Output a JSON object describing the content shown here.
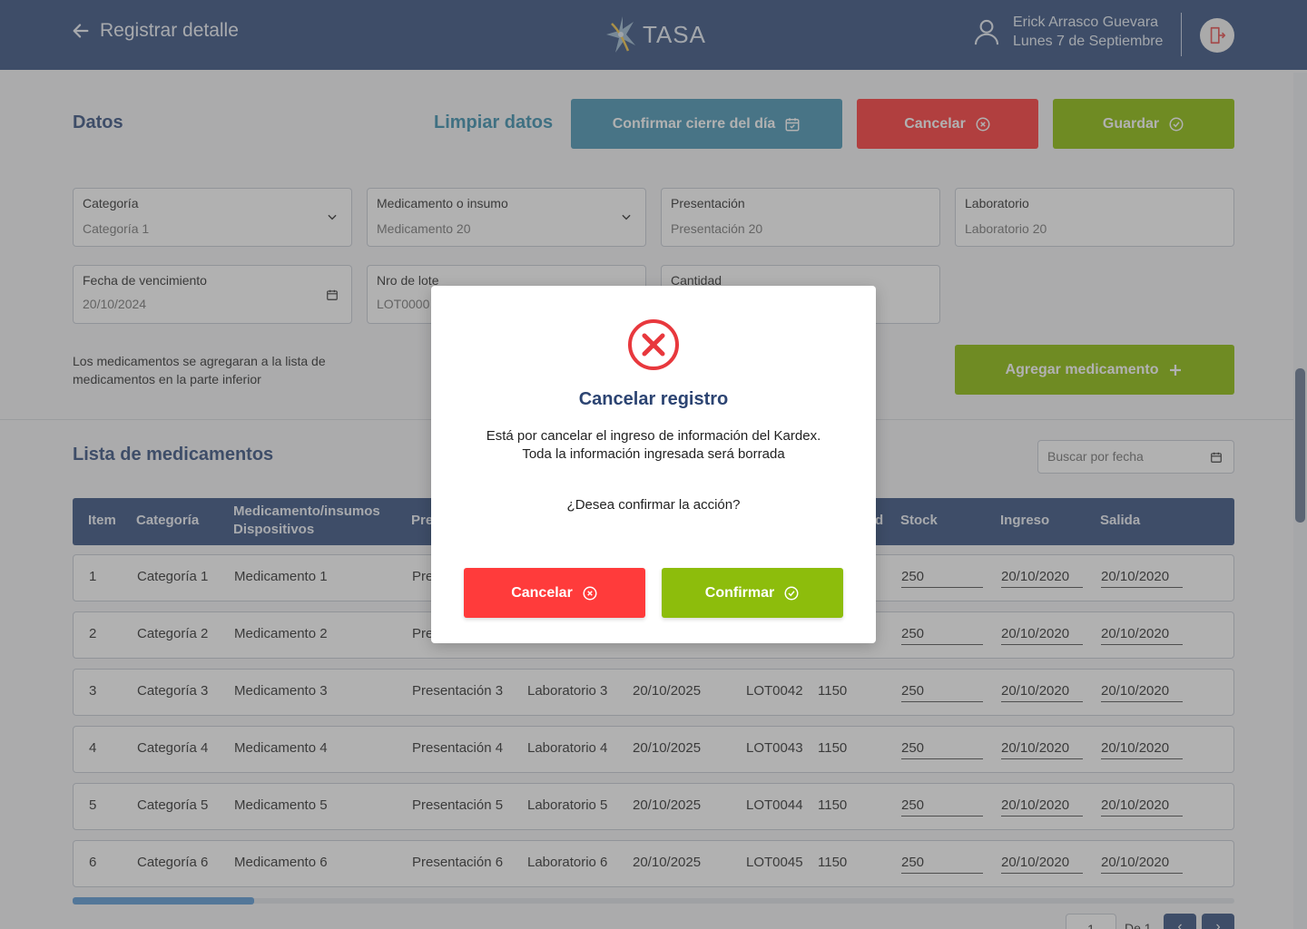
{
  "header": {
    "back_label": "Registrar detalle",
    "logo_text": "TASA",
    "user_name": "Erick Arrasco Guevara",
    "date": "Lunes 7 de Septiembre"
  },
  "datos": {
    "title": "Datos",
    "clear_label": "Limpiar datos",
    "confirm_close_label": "Confirmar cierre del día",
    "cancel_label": "Cancelar",
    "save_label": "Guardar"
  },
  "fields": {
    "categoria": {
      "label": "Categoría",
      "value": "Categoría 1"
    },
    "medicamento": {
      "label": "Medicamento o insumo",
      "value": "Medicamento 20"
    },
    "presentacion": {
      "label": "Presentación",
      "value": "Presentación 20"
    },
    "laboratorio": {
      "label": "Laboratorio",
      "value": "Laboratorio 20"
    },
    "fecha": {
      "label": "Fecha de vencimiento",
      "value": "20/10/2024"
    },
    "lote": {
      "label": "Nro de lote",
      "value": "LOT0000"
    },
    "cantidad": {
      "label": "Cantidad",
      "value": ""
    }
  },
  "note": "Los medicamentos se agregaran a la lista de medicamentos en la parte inferior",
  "add_label": "Agregar medicamento",
  "list": {
    "title": "Lista de medicamentos",
    "search_placeholder": "Buscar por fecha",
    "headers": {
      "item": "Item",
      "categoria": "Categoría",
      "medicamento_1": "Medicamento/insumos",
      "medicamento_2": "Dispositivos",
      "presentacion": "Pre",
      "cantidad_tail": "d",
      "stock": "Stock",
      "ingreso": "Ingreso",
      "salida": "Salida"
    },
    "rows": [
      {
        "item": "1",
        "categoria": "Categoría 1",
        "medicamento": "Medicamento 1",
        "presentacion": "Pre",
        "laboratorio": "",
        "fecha": "",
        "lote": "",
        "cantidad": "",
        "stock": "250",
        "ingreso": "20/10/2020",
        "salida": "20/10/2020"
      },
      {
        "item": "2",
        "categoria": "Categoría 2",
        "medicamento": "Medicamento 2",
        "presentacion": "Pre",
        "laboratorio": "",
        "fecha": "",
        "lote": "",
        "cantidad": "",
        "stock": "250",
        "ingreso": "20/10/2020",
        "salida": "20/10/2020"
      },
      {
        "item": "3",
        "categoria": "Categoría 3",
        "medicamento": "Medicamento 3",
        "presentacion": "Presentación 3",
        "laboratorio": "Laboratorio 3",
        "fecha": "20/10/2025",
        "lote": "LOT0042",
        "cantidad": "1150",
        "stock": "250",
        "ingreso": "20/10/2020",
        "salida": "20/10/2020"
      },
      {
        "item": "4",
        "categoria": "Categoría 4",
        "medicamento": "Medicamento 4",
        "presentacion": "Presentación 4",
        "laboratorio": "Laboratorio 4",
        "fecha": "20/10/2025",
        "lote": "LOT0043",
        "cantidad": "1150",
        "stock": "250",
        "ingreso": "20/10/2020",
        "salida": "20/10/2020"
      },
      {
        "item": "5",
        "categoria": "Categoría 5",
        "medicamento": "Medicamento 5",
        "presentacion": "Presentación 5",
        "laboratorio": "Laboratorio 5",
        "fecha": "20/10/2025",
        "lote": "LOT0044",
        "cantidad": "1150",
        "stock": "250",
        "ingreso": "20/10/2020",
        "salida": "20/10/2020"
      },
      {
        "item": "6",
        "categoria": "Categoría 6",
        "medicamento": "Medicamento 6",
        "presentacion": "Presentación 6",
        "laboratorio": "Laboratorio 6",
        "fecha": "20/10/2025",
        "lote": "LOT0045",
        "cantidad": "1150",
        "stock": "250",
        "ingreso": "20/10/2020",
        "salida": "20/10/2020"
      }
    ]
  },
  "pager": {
    "page": "1",
    "of": "De 1"
  },
  "modal": {
    "title": "Cancelar registro",
    "line1": "Está por cancelar el ingreso de información del Kardex.",
    "line2": "Toda la información ingresada será borrada",
    "question": "¿Desea confirmar la acción?",
    "cancel_label": "Cancelar",
    "confirm_label": "Confirmar"
  },
  "colors": {
    "header": "#3a5381",
    "confirm_close": "#4a97b6",
    "cancel": "#ff3b3b",
    "save": "#8dbd0c",
    "error_icon": "#e8383d"
  }
}
